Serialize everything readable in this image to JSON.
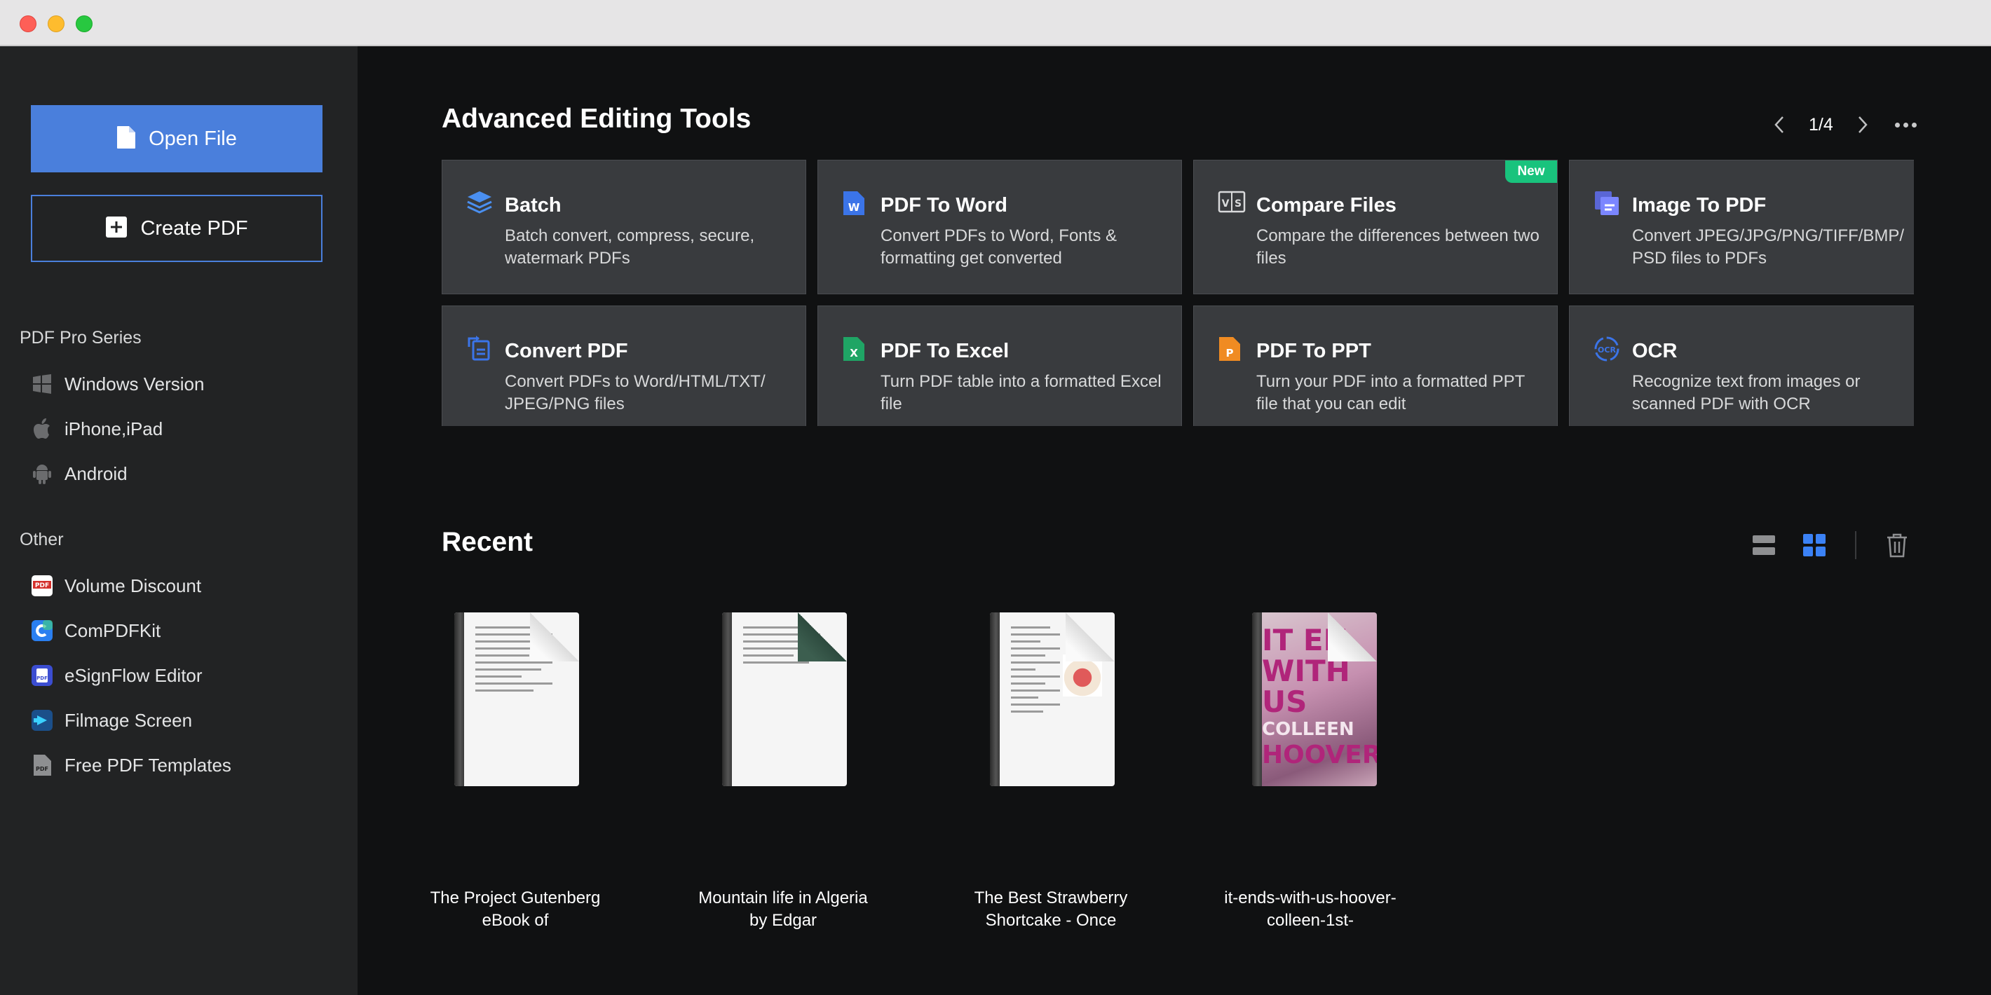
{
  "sidebar": {
    "open_file": "Open File",
    "create_pdf": "Create PDF",
    "pro_series": {
      "title": "PDF Pro Series",
      "items": [
        {
          "label": "Windows Version",
          "icon": "windows-icon"
        },
        {
          "label": "iPhone,iPad",
          "icon": "apple-icon"
        },
        {
          "label": "Android",
          "icon": "android-icon"
        }
      ]
    },
    "other": {
      "title": "Other",
      "items": [
        {
          "label": "Volume Discount",
          "icon": "volume-discount-icon"
        },
        {
          "label": "ComPDFKit",
          "icon": "compdfkit-icon"
        },
        {
          "label": "eSignFlow Editor",
          "icon": "esignflow-icon"
        },
        {
          "label": "Filmage Screen",
          "icon": "filmage-icon"
        },
        {
          "label": "Free PDF Templates",
          "icon": "pdf-template-icon"
        }
      ]
    }
  },
  "tools": {
    "title": "Advanced Editing Tools",
    "page": "1/4",
    "cards": [
      {
        "title": "Batch",
        "desc": "Batch convert, compress, secure, watermark PDFs",
        "icon": "batch-layers-icon"
      },
      {
        "title": "PDF To Word",
        "desc": "Convert PDFs to Word, Fonts & formatting get converted",
        "icon": "word-icon"
      },
      {
        "title": "Compare Files",
        "desc": "Compare the differences between two files",
        "icon": "compare-icon",
        "badge": "New"
      },
      {
        "title": "Image To PDF",
        "desc": "Convert JPEG/JPG/PNG/TIFF/BMP/ PSD files to PDFs",
        "icon": "image-to-pdf-icon"
      },
      {
        "title": "Convert PDF",
        "desc": "Convert PDFs to Word/HTML/TXT/ JPEG/PNG files",
        "icon": "convert-icon"
      },
      {
        "title": "PDF To Excel",
        "desc": "Turn PDF table into a formatted Excel file",
        "icon": "excel-icon"
      },
      {
        "title": "PDF To PPT",
        "desc": "Turn your PDF into a formatted PPT file that you can edit",
        "icon": "ppt-icon"
      },
      {
        "title": "OCR",
        "desc": "Recognize text from images or scanned PDF with OCR",
        "icon": "ocr-icon"
      }
    ]
  },
  "recent": {
    "title": "Recent",
    "files": [
      {
        "name": "The Project Gutenberg eBook of"
      },
      {
        "name": "Mountain life in Algeria by Edgar"
      },
      {
        "name": "The Best Strawberry Shortcake - Once"
      },
      {
        "name": "it-ends-with-us-hoover-colleen-1st-"
      }
    ],
    "cover_text": [
      "IT EN",
      "WITH",
      "US",
      "COLLEEN",
      "HOOVER"
    ]
  },
  "colors": {
    "accent": "#4a7fdc",
    "card_bg": "#393b3e",
    "badge": "#19c37d",
    "sidebar_bg": "#222324",
    "main_bg": "#101112"
  }
}
